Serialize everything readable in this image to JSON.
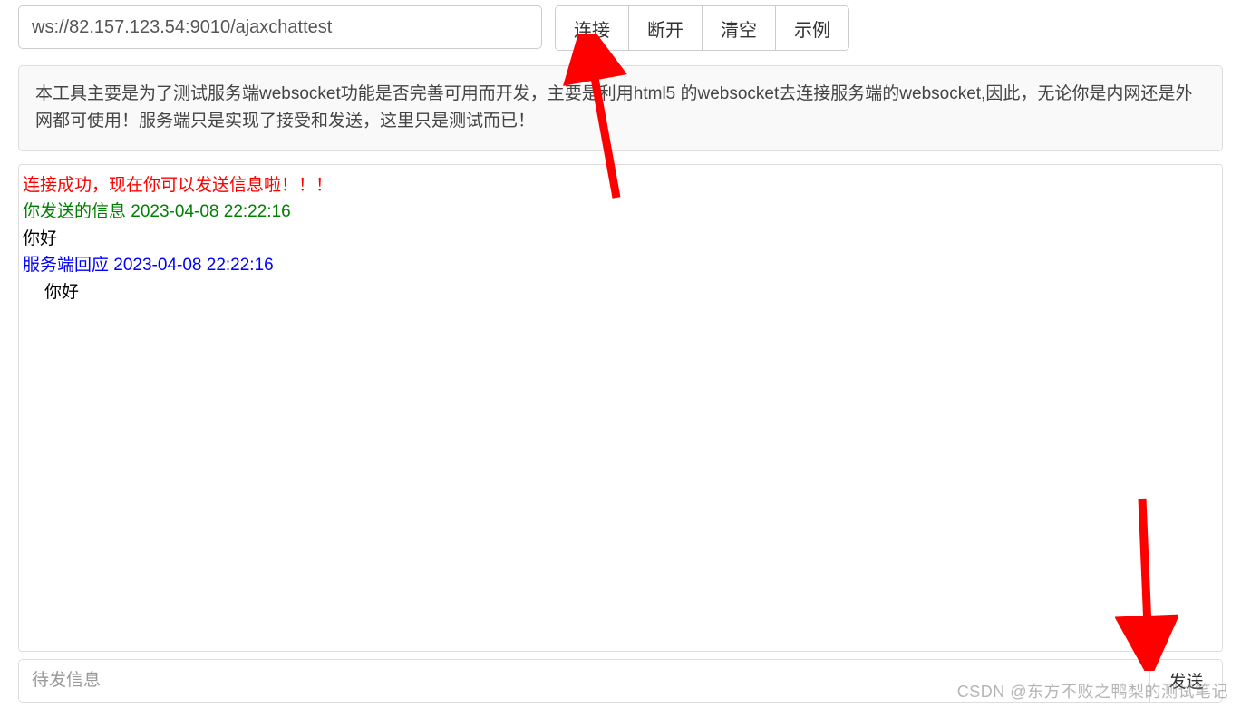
{
  "url_input": {
    "value": "ws://82.157.123.54:9010/ajaxchattest"
  },
  "buttons": {
    "connect": "连接",
    "disconnect": "断开",
    "clear": "清空",
    "example": "示例"
  },
  "info_text": "本工具主要是为了测试服务端websocket功能是否完善可用而开发，主要是利用html5  的websocket去连接服务端的websocket,因此，无论你是内网还是外网都可使用！服务端只是实现了接受和发送，这里只是测试而已！",
  "log": {
    "lines": [
      {
        "cls": "log-line-red",
        "text": "连接成功，现在你可以发送信息啦！！！"
      },
      {
        "cls": "log-line-green",
        "text": "你发送的信息 2023-04-08 22:22:16"
      },
      {
        "cls": "log-line-black",
        "text": "你好"
      },
      {
        "cls": "log-line-blue",
        "text": "服务端回应 2023-04-08 22:22:16"
      },
      {
        "cls": "log-line-indent",
        "text": "你好"
      }
    ]
  },
  "send": {
    "placeholder": "待发信息",
    "button": "发送"
  },
  "watermark": "CSDN @东方不败之鸭梨的测试笔记"
}
